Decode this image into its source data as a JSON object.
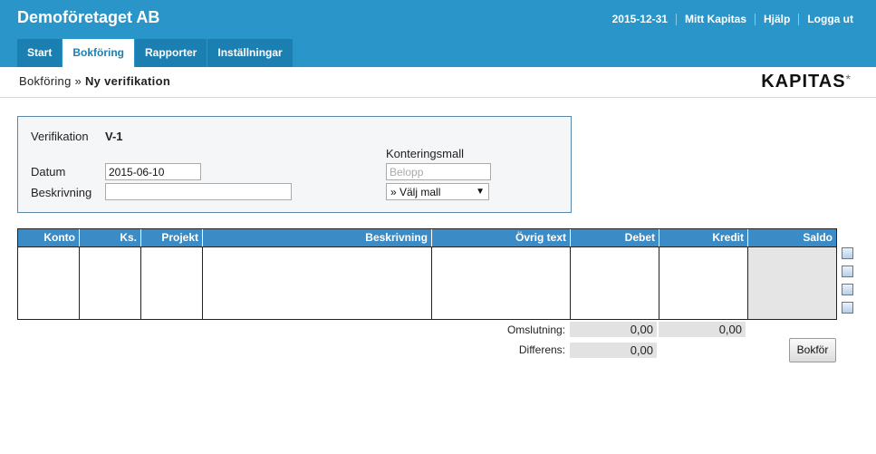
{
  "header": {
    "company": "Demoföretaget AB",
    "date": "2015-12-31",
    "links": [
      "Mitt Kapitas",
      "Hjälp",
      "Logga ut"
    ]
  },
  "tabs": [
    {
      "label": "Start",
      "active": false
    },
    {
      "label": "Bokföring",
      "active": true
    },
    {
      "label": "Rapporter",
      "active": false
    },
    {
      "label": "Inställningar",
      "active": false
    }
  ],
  "breadcrumb": {
    "parent": "Bokföring",
    "separator": " » ",
    "current": "Ny verifikation"
  },
  "logo": {
    "text": "KAPITAS",
    "mark": "*"
  },
  "form": {
    "verification_label": "Verifikation",
    "verification_value": "V-1",
    "date_label": "Datum",
    "date_value": "2015-06-10",
    "description_label": "Beskrivning",
    "description_value": "",
    "template_label": "Konteringsmall",
    "amount_placeholder": "Belopp",
    "template_select": "» Välj mall",
    "template_arrow": "▼"
  },
  "table": {
    "columns": [
      "Konto",
      "Ks.",
      "Projekt",
      "Beskrivning",
      "Övrig text",
      "Debet",
      "Kredit",
      "Saldo"
    ]
  },
  "totals": {
    "turnover_label": "Omslutning:",
    "turnover_debit": "0,00",
    "turnover_credit": "0,00",
    "difference_label": "Differens:",
    "difference_value": "0,00"
  },
  "actions": {
    "book_label": "Bokför"
  },
  "colors": {
    "header_bg": "#2a95c9",
    "tab_bg": "#1b7fb2",
    "table_header": "#3b8cc6"
  },
  "icons": {
    "side_icons": [
      "row-icon",
      "row-icon",
      "row-icon",
      "row-icon"
    ]
  }
}
